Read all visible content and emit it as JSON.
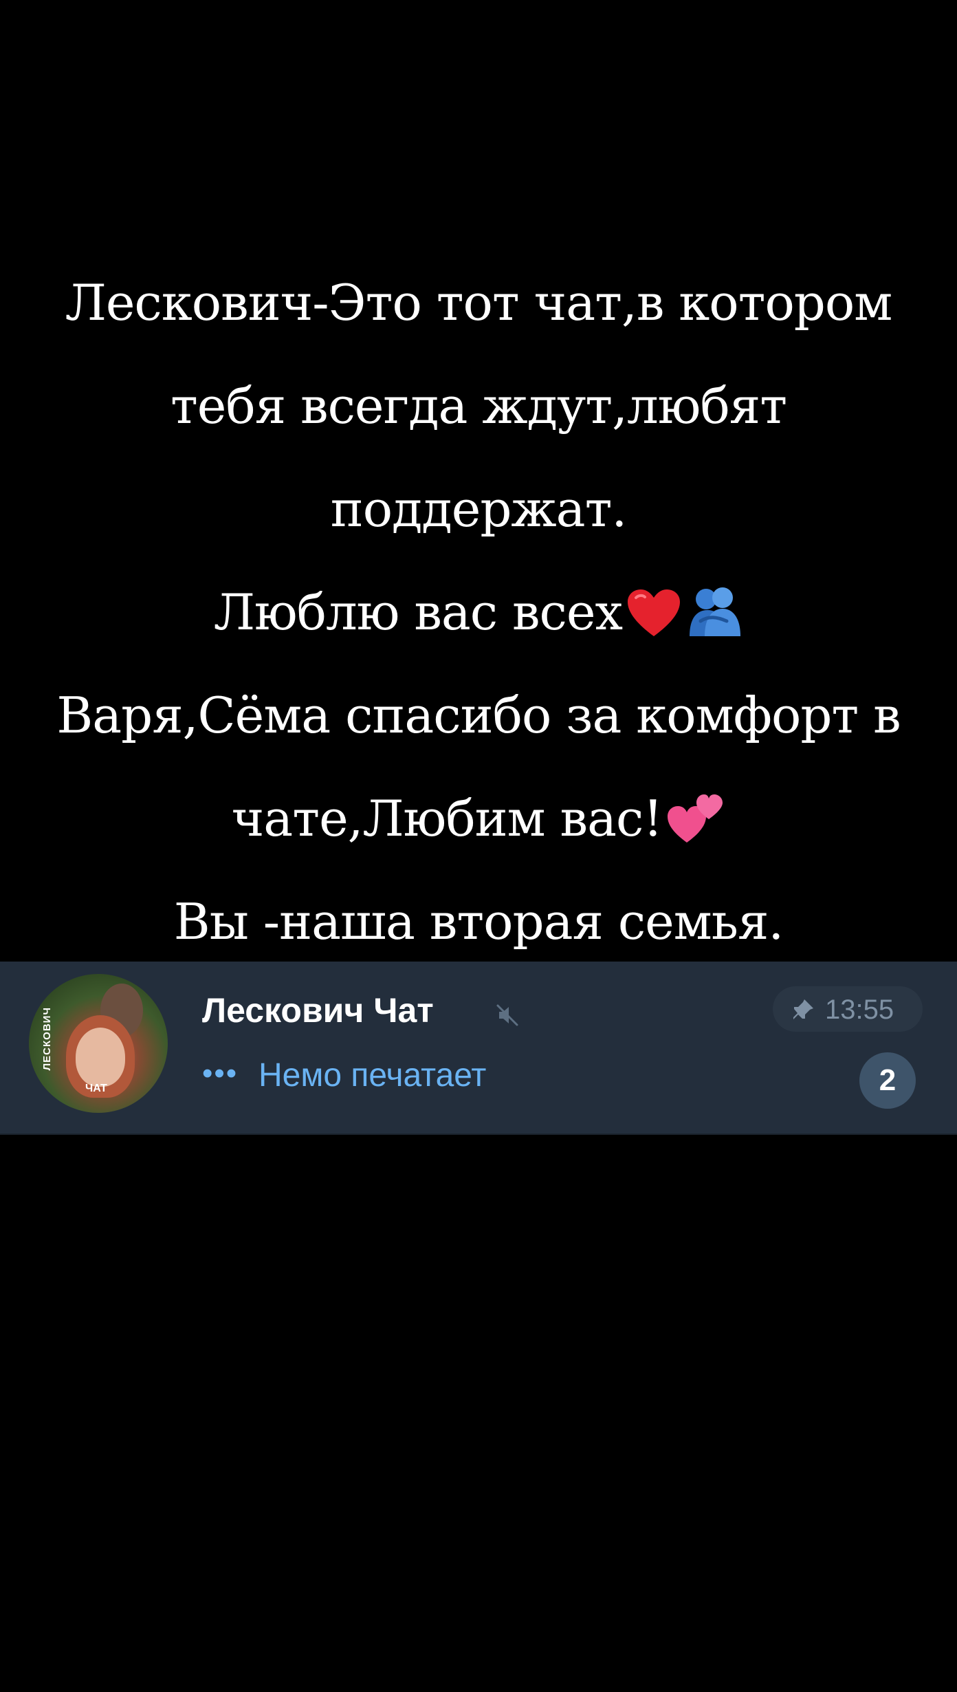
{
  "caption": {
    "lines": [
      "Лескович-Это тот чат,в котором",
      "тебя всегда ждут,любят",
      "поддержат.",
      "Люблю вас всех",
      "Варя,Сёма спасибо за комфорт в",
      "чате,Любим вас!",
      "Вы -наша вторая семья."
    ]
  },
  "chat": {
    "title": "Лескович Чат",
    "avatar_text_vertical": "ЛЕСКОВИЧ",
    "avatar_text_bottom": "ЧАТ",
    "typing_dots": "•••",
    "typing_text": "Немо печатает",
    "time": "13:55",
    "unread_count": "2",
    "muted": true,
    "pinned": true
  },
  "colors": {
    "background": "#000000",
    "chat_row_bg": "#232e3c",
    "typing_accent": "#6ab3f3",
    "badge_bg": "#3e546a"
  },
  "icons": {
    "heart": "red-heart-icon",
    "hug": "people-hugging-icon",
    "two_hearts": "two-hearts-icon",
    "mute": "muted-speaker-icon",
    "pin": "pin-icon"
  }
}
